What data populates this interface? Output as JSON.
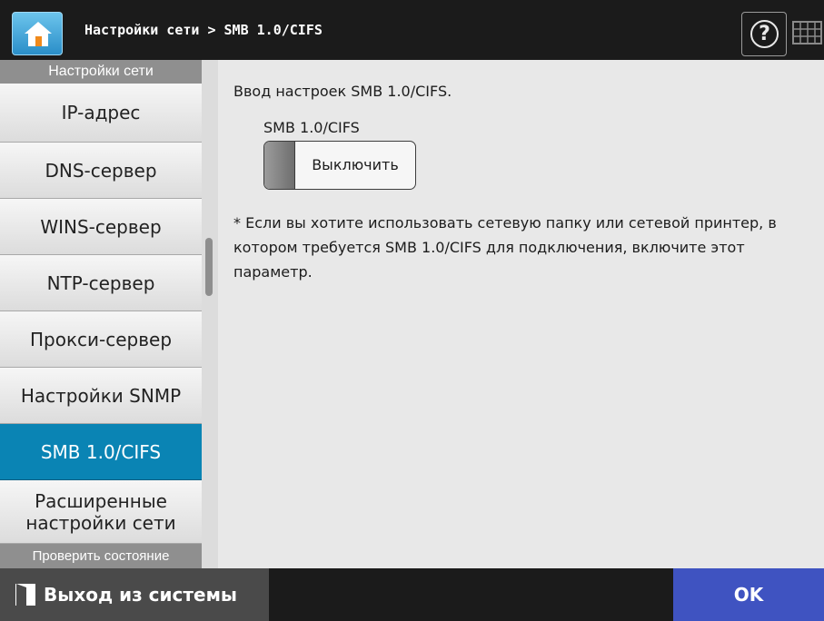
{
  "header": {
    "title": "Настройки сети > SMB 1.0/CIFS",
    "home_icon": "home-icon",
    "help_symbol": "?",
    "help_icon": "help-icon",
    "keyboard_icon": "keyboard-icon"
  },
  "sidebar": {
    "group_label": "Настройки сети",
    "items": [
      {
        "label": "IP-адрес"
      },
      {
        "label": "DNS-сервер"
      },
      {
        "label": "WINS-сервер"
      },
      {
        "label": "NTP-сервер"
      },
      {
        "label": "Прокси-сервер"
      },
      {
        "label": "Настройки SNMP"
      },
      {
        "label": "SMB 1.0/CIFS",
        "selected": true
      },
      {
        "label_line1": "Расширенные",
        "label_line2": "настройки сети"
      }
    ],
    "next_group_label": "Проверить состояние"
  },
  "content": {
    "intro": "Ввод настроек SMB 1.0/CIFS.",
    "field_label": "SMB 1.0/CIFS",
    "toggle_label": "Выключить",
    "note": "* Если вы хотите использовать сетевую папку или сетевой принтер, в котором требуется SMB 1.0/CIFS для подключения, включите этот параметр."
  },
  "footer": {
    "logout_label": "Выход из системы",
    "logout_icon": "logout-door-icon",
    "ok_label": "OK"
  },
  "colors": {
    "accent_selected": "#0a84b4",
    "ok_button": "#3f53c1",
    "header_bg": "#1b1b1b"
  }
}
